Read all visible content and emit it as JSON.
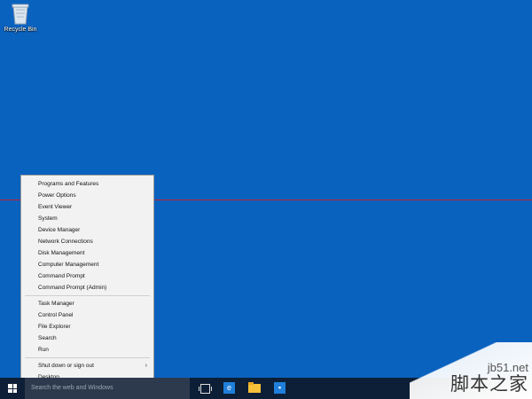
{
  "desktop": {
    "recycle_bin_label": "Recycle Bin"
  },
  "menu": {
    "groups": [
      [
        "Programs and Features",
        "Power Options",
        "Event Viewer",
        "System",
        "Device Manager",
        "Network Connections",
        "Disk Management",
        "Computer Management",
        "Command Prompt",
        "Command Prompt (Admin)"
      ],
      [
        "Task Manager",
        "Control Panel",
        "File Explorer",
        "Search",
        "Run"
      ],
      [
        "Shut down or sign out",
        "Desktop"
      ]
    ],
    "submenu_item": "Shut down or sign out",
    "submenu_arrow": "›"
  },
  "taskbar": {
    "search_placeholder": "Search the web and Windows",
    "icons": [
      "windows-logo-icon",
      "task-view-icon",
      "internet-explorer-icon",
      "file-explorer-icon",
      "store-icon"
    ]
  },
  "watermark": {
    "url": "jb51.net",
    "chinese": "脚本之家"
  },
  "colors": {
    "desktop": "#0a62bf",
    "taskbar": "#0d1f36",
    "menu_bg": "#f2f2f2",
    "highlight_line": "#b81f2f"
  }
}
